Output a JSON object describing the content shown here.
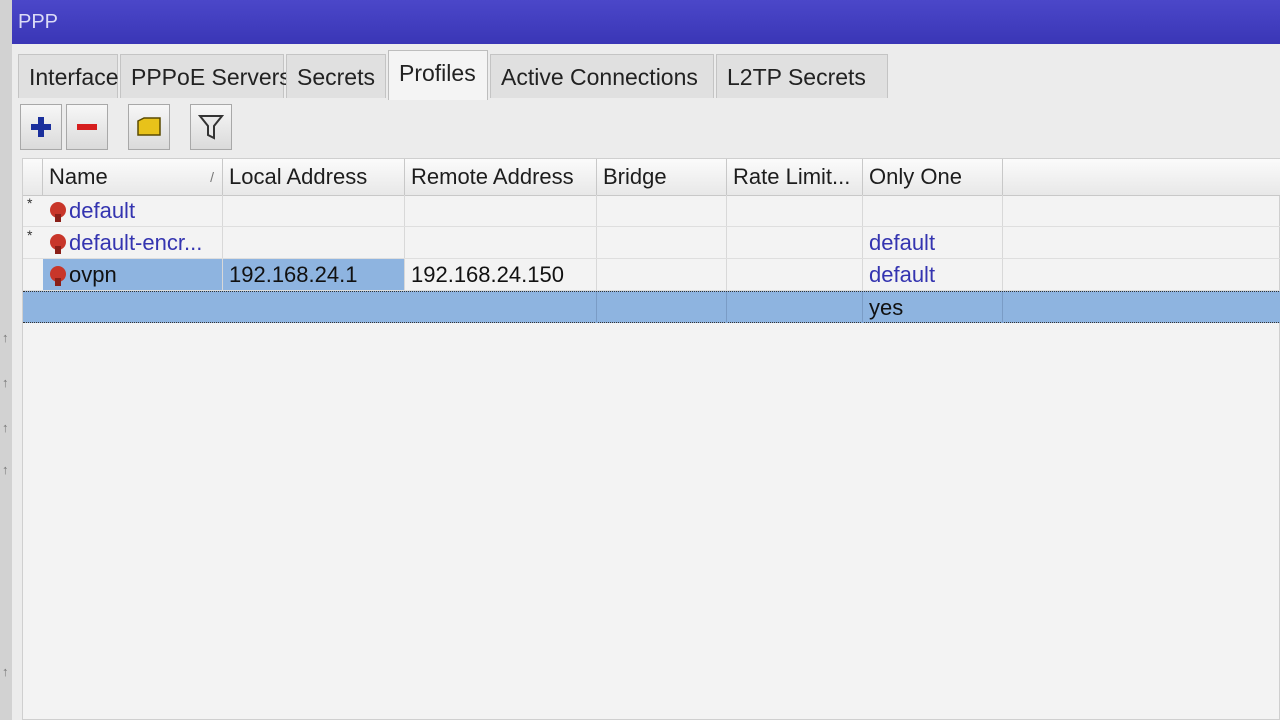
{
  "window": {
    "title": "PPP"
  },
  "tabs": [
    {
      "label": "Interface",
      "active": false
    },
    {
      "label": "PPPoE Servers",
      "active": false
    },
    {
      "label": "Secrets",
      "active": false
    },
    {
      "label": "Profiles",
      "active": true
    },
    {
      "label": "Active Connections",
      "active": false
    },
    {
      "label": "L2TP Secrets",
      "active": false
    }
  ],
  "toolbar": {
    "buttons": [
      {
        "icon": "plus-icon",
        "color": "#1a2f9c"
      },
      {
        "icon": "minus-icon",
        "color": "#d61e1e"
      },
      {
        "icon": "comment-icon",
        "color": "#e8c21a"
      },
      {
        "icon": "filter-icon",
        "color": "#3a3a3a"
      }
    ]
  },
  "table": {
    "columns": [
      "Name",
      "Local Address",
      "Remote Address",
      "Bridge",
      "Rate Limit...",
      "Only One"
    ],
    "sort_column": "Name",
    "rows": [
      {
        "flag": "*",
        "name": "default",
        "local": "",
        "remote": "",
        "bridge": "",
        "rate": "",
        "only_one": "",
        "selected": false
      },
      {
        "flag": "*",
        "name": "default-encr...",
        "local": "",
        "remote": "",
        "bridge": "",
        "rate": "",
        "only_one": "default",
        "selected": false
      },
      {
        "flag": "",
        "name": "ovpn",
        "local": "192.168.24.1",
        "remote": "192.168.24.150",
        "bridge": "",
        "rate": "",
        "only_one": "default",
        "selected": false
      }
    ],
    "extra_row": {
      "only_one": "yes"
    }
  },
  "colors": {
    "accent": "#3a36b6",
    "selected_row": "#8eb4e0",
    "link_text": "#3434b0"
  }
}
